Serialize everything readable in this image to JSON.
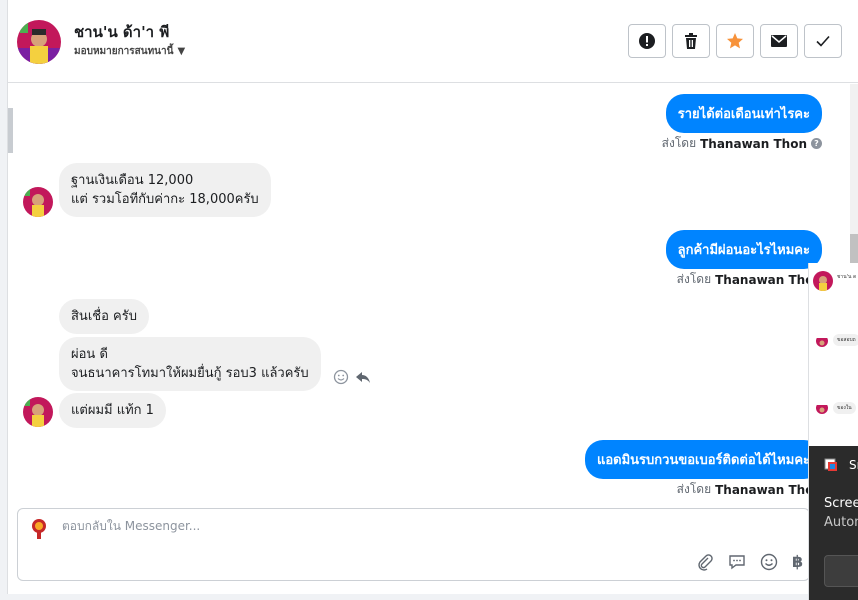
{
  "header": {
    "contact_name": "ชาน'น ด้า'า พี",
    "assign_label": "มอบหมายการสนทนานี้",
    "toolbar": [
      {
        "name": "alert",
        "icon": "exclamation-circle-icon"
      },
      {
        "name": "delete",
        "icon": "trash-icon"
      },
      {
        "name": "star",
        "icon": "star-icon"
      },
      {
        "name": "mail",
        "icon": "envelope-icon"
      },
      {
        "name": "done",
        "icon": "check-icon"
      }
    ]
  },
  "messages": {
    "out1": "รายได้ต่อเดือนเท่าไรคะ",
    "out1_sentby_prefix": "ส่งโดย",
    "out1_sentby_name": "Thanawan Thon",
    "in1_line1": "ฐานเงินเดือน 12,000",
    "in1_line2": "แต่ รวมโอทีกับค่ากะ 18,000ครับ",
    "out2": "ลูกค้ามีผ่อนอะไรไหมคะ",
    "out2_sentby_prefix": "ส่งโดย",
    "out2_sentby_name": "Thanawan Thon",
    "in2": "สินเชื่อ ครับ",
    "in3_line1": "ผ่อน ดี",
    "in3_line2": "จนธนาคารโทมาให้ผมยื่นกู้ รอบ3 แล้วครับ",
    "in4": "แต่ผมมี แท้ก 1",
    "out3": "แอดมินรบกวนขอเบอร์ติดต่อได้ไหมคะ",
    "out3_sentby_prefix": "ส่งโดย",
    "out3_sentby_name": "Thanawan Thon"
  },
  "composer": {
    "placeholder": "ตอบกลับใน Messenger...",
    "tools": [
      "paperclip-icon",
      "speech-bubble-icon",
      "smiley-icon",
      "baht-icon"
    ],
    "baht_symbol": "฿"
  },
  "popup": {
    "mini_name": "ชาน'น ด",
    "mini_bubble1": "ขอสอบถ",
    "mini_bubble2": "ของใน",
    "dark_title": "Sn",
    "dark_line1": "Scree",
    "dark_line2": "Autom"
  },
  "colors": {
    "accent_blue": "#0084ff",
    "star_orange": "#f7923a",
    "incoming_bg": "#f0f0f0"
  }
}
